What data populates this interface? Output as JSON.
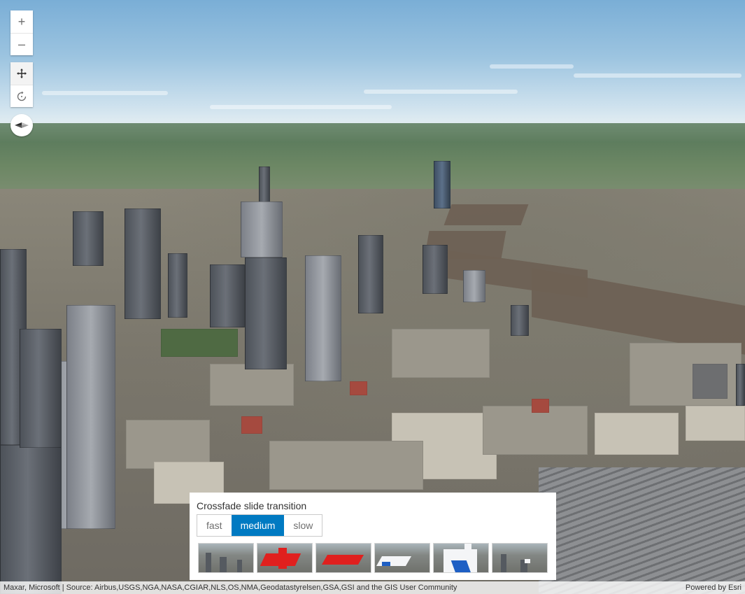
{
  "controls": {
    "zoom_in_glyph": "+",
    "zoom_out_glyph": "–",
    "pan_icon": "pan-icon",
    "rotate_icon": "rotate-icon",
    "compass_icon": "compass-icon"
  },
  "slides_panel": {
    "title": "Crossfade slide transition",
    "speed_options": [
      {
        "label": "fast",
        "selected": false
      },
      {
        "label": "medium",
        "selected": true
      },
      {
        "label": "slow",
        "selected": false
      }
    ],
    "accent_color": "#007ac2",
    "slide_count": 6
  },
  "attribution": {
    "sources": "Maxar, Microsoft | Source: Airbus,USGS,NGA,NASA,CGIAR,NLS,OS,NMA,Geodatastyrelsen,GSA,GSI and the GIS User Community",
    "powered_by": "Powered by Esri"
  }
}
